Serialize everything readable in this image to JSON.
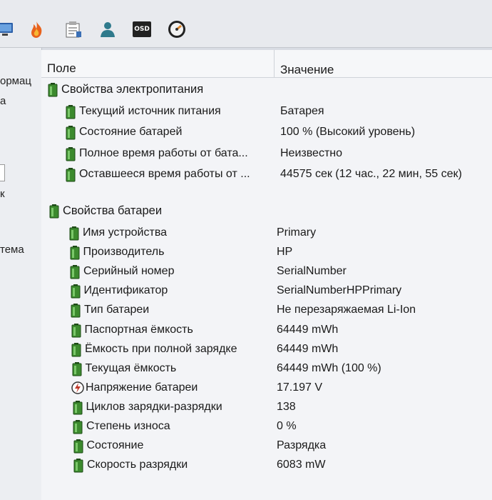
{
  "toolbar": {
    "buttons": [
      {
        "icon": "computer-icon"
      },
      {
        "icon": "flame-icon"
      },
      {
        "icon": "report-icon"
      },
      {
        "icon": "user-icon"
      },
      {
        "icon": "osd-icon",
        "label": "OSD"
      },
      {
        "icon": "gauge-icon"
      }
    ]
  },
  "sidebar": {
    "fragments": [
      "ормац",
      "а",
      "к",
      "тема"
    ]
  },
  "table": {
    "col_field": "Поле",
    "col_value": "Значение",
    "groups": [
      {
        "title": "Свойства электропитания",
        "rows": [
          {
            "field": "Текущий источник питания",
            "value": "Батарея",
            "icon": "battery-icon"
          },
          {
            "field": "Состояние батарей",
            "value": "100 % (Высокий уровень)",
            "icon": "battery-icon"
          },
          {
            "field": "Полное время работы от бата...",
            "value": "Неизвестно",
            "icon": "battery-icon"
          },
          {
            "field": "Оставшееся время работы от ...",
            "value": "44575 сек (12 час., 22 мин, 55 сек)",
            "icon": "battery-icon"
          }
        ]
      },
      {
        "title": "Свойства батареи",
        "rows": [
          {
            "field": "Имя устройства",
            "value": "Primary",
            "icon": "battery-icon"
          },
          {
            "field": "Производитель",
            "value": "HP",
            "icon": "battery-icon"
          },
          {
            "field": "Серийный номер",
            "value": "SerialNumber",
            "icon": "battery-icon"
          },
          {
            "field": "Идентификатор",
            "value": "SerialNumberHPPrimary",
            "icon": "battery-icon"
          },
          {
            "field": "Тип батареи",
            "value": "Не перезаряжаемая Li-Ion",
            "icon": "battery-icon"
          },
          {
            "field": "Паспортная ёмкость",
            "value": "64449 mWh",
            "icon": "battery-icon"
          },
          {
            "field": "Ёмкость при полной зарядке",
            "value": "64449 mWh",
            "icon": "battery-icon"
          },
          {
            "field": "Текущая ёмкость",
            "value": "64449 mWh  (100 %)",
            "icon": "battery-icon"
          },
          {
            "field": "Напряжение батареи",
            "value": "17.197 V",
            "icon": "voltage-icon"
          },
          {
            "field": "Циклов зарядки-разрядки",
            "value": "138",
            "icon": "battery-icon"
          },
          {
            "field": "Степень износа",
            "value": "0 %",
            "icon": "battery-icon"
          },
          {
            "field": "Состояние",
            "value": "Разрядка",
            "icon": "battery-icon"
          },
          {
            "field": "Скорость разрядки",
            "value": "6083 mW",
            "icon": "battery-icon"
          }
        ]
      }
    ]
  },
  "colors": {
    "battery_green": "#3c8a2e",
    "battery_dark": "#1d4a16"
  }
}
